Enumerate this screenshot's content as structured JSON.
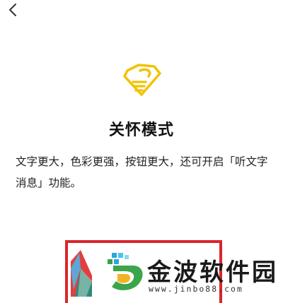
{
  "nav": {
    "back_icon": "chevron-left-icon"
  },
  "hero": {
    "icon": "care-heart-hand-icon",
    "icon_color": "#f2c200"
  },
  "content": {
    "title": "关怀模式",
    "description": "文字更大，色彩更强，按钮更大，还可开启「听文字消息」功能。"
  },
  "highlight": {
    "border_color": "#d9262b"
  },
  "watermark": {
    "brand": "金波软件园",
    "url": "www.jinbo88.com"
  }
}
